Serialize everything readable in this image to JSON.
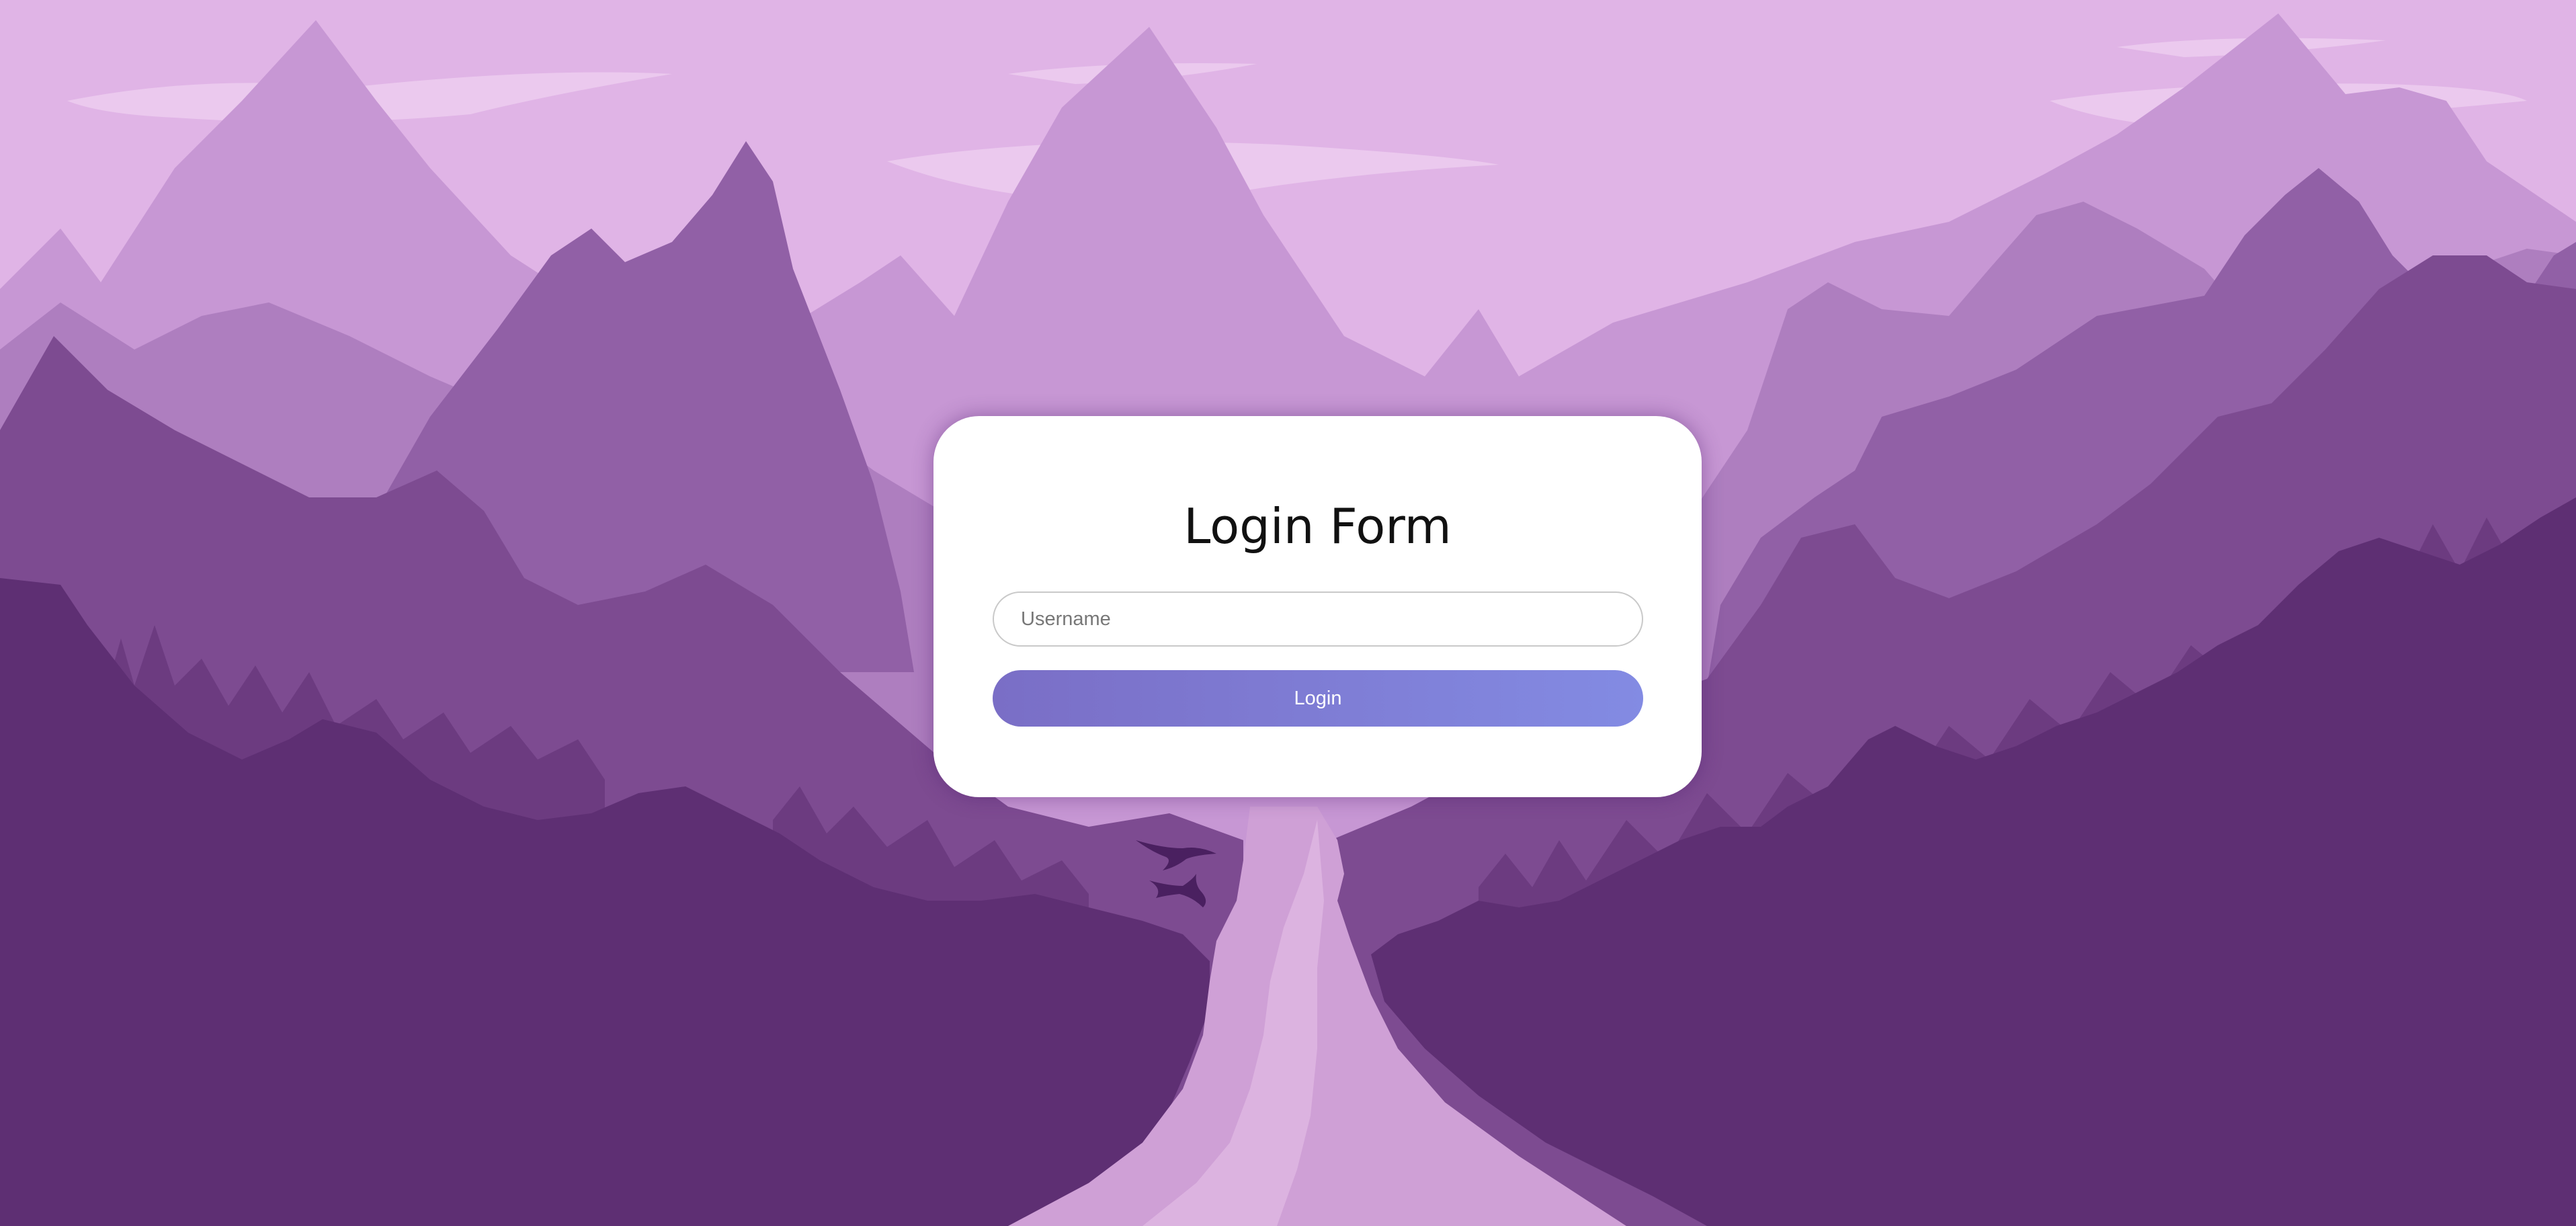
{
  "login_form": {
    "title": "Login Form",
    "username_placeholder": "Username",
    "username_value": "",
    "login_label": "Login"
  },
  "colors": {
    "sky": "#e0b4e6",
    "card": "#ffffff",
    "button_start": "#7a6ec6",
    "button_end": "#838be3",
    "foreground_cliffs": "#5e2f73",
    "river": "#cfa0d6"
  }
}
